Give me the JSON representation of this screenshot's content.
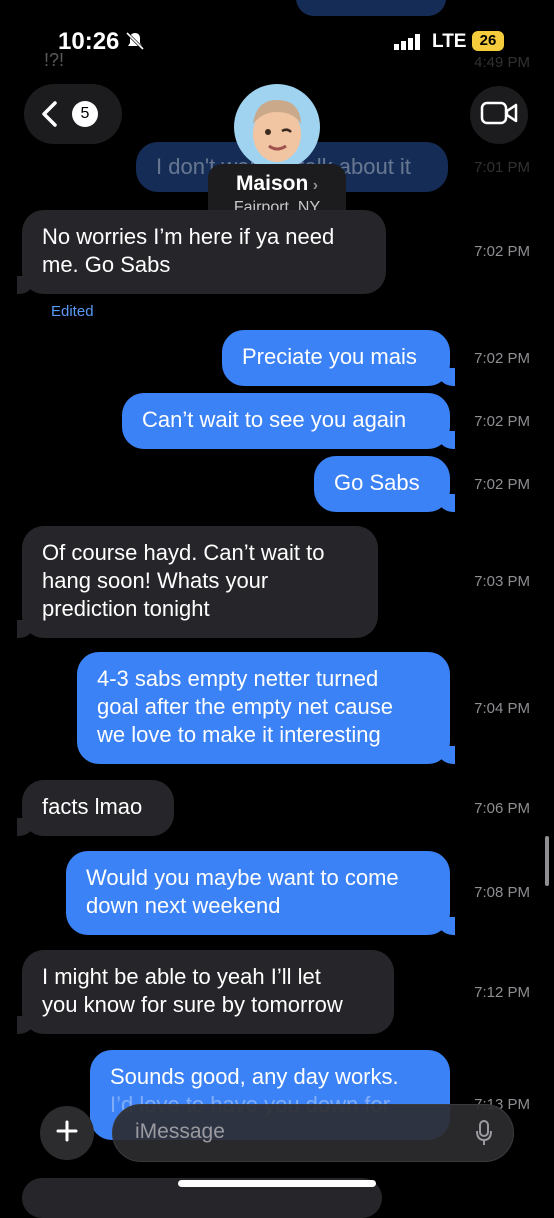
{
  "status": {
    "time": "10:26",
    "network": "LTE",
    "battery": "26"
  },
  "nav": {
    "back_count": "5",
    "contact_name": "Maison",
    "contact_location": "Fairport, NY"
  },
  "background_texts": {
    "top_left": "!?!",
    "top_time": "4:49 PM",
    "faded_msg": "I don't want to talk about it",
    "faded_time": "7:01 PM"
  },
  "messages": [
    {
      "side": "in",
      "text": "No worries I’m here if ya need me. Go Sabs",
      "lines": [
        "No worries I’m here if ya need",
        "me. Go Sabs"
      ],
      "time": "7:02 PM",
      "edited": "Edited"
    },
    {
      "side": "out",
      "lines": [
        "Preciate you mais"
      ],
      "time": "7:02 PM"
    },
    {
      "side": "out",
      "lines": [
        "Can’t wait to see you again"
      ],
      "time": "7:02 PM"
    },
    {
      "side": "out",
      "lines": [
        "Go Sabs"
      ],
      "time": "7:02 PM"
    },
    {
      "side": "in",
      "lines": [
        "Of course hayd. Can’t wait to",
        "hang soon! Whats your",
        "prediction tonight"
      ],
      "time": "7:03 PM"
    },
    {
      "side": "out",
      "lines": [
        "4-3 sabs empty netter turned",
        "goal after the empty net cause",
        "we love to make it interesting"
      ],
      "time": "7:04 PM"
    },
    {
      "side": "in",
      "lines": [
        "facts lmao"
      ],
      "time": "7:06 PM"
    },
    {
      "side": "out",
      "lines": [
        "Would you maybe want to come",
        "down next weekend"
      ],
      "time": "7:08 PM"
    },
    {
      "side": "in",
      "lines": [
        "I might be able to yeah I’ll let",
        "you know for sure by tomorrow"
      ],
      "time": "7:12 PM"
    },
    {
      "side": "out",
      "lines": [
        "Sounds good, any day works.",
        "I’d love to have you down for"
      ],
      "time": "7:13 PM"
    }
  ],
  "compose": {
    "placeholder": "iMessage"
  },
  "icons": {
    "back": "chevron-left-icon",
    "video": "video-camera-icon",
    "plus": "plus-icon",
    "mic": "microphone-icon",
    "silent": "bell-slash-icon"
  }
}
